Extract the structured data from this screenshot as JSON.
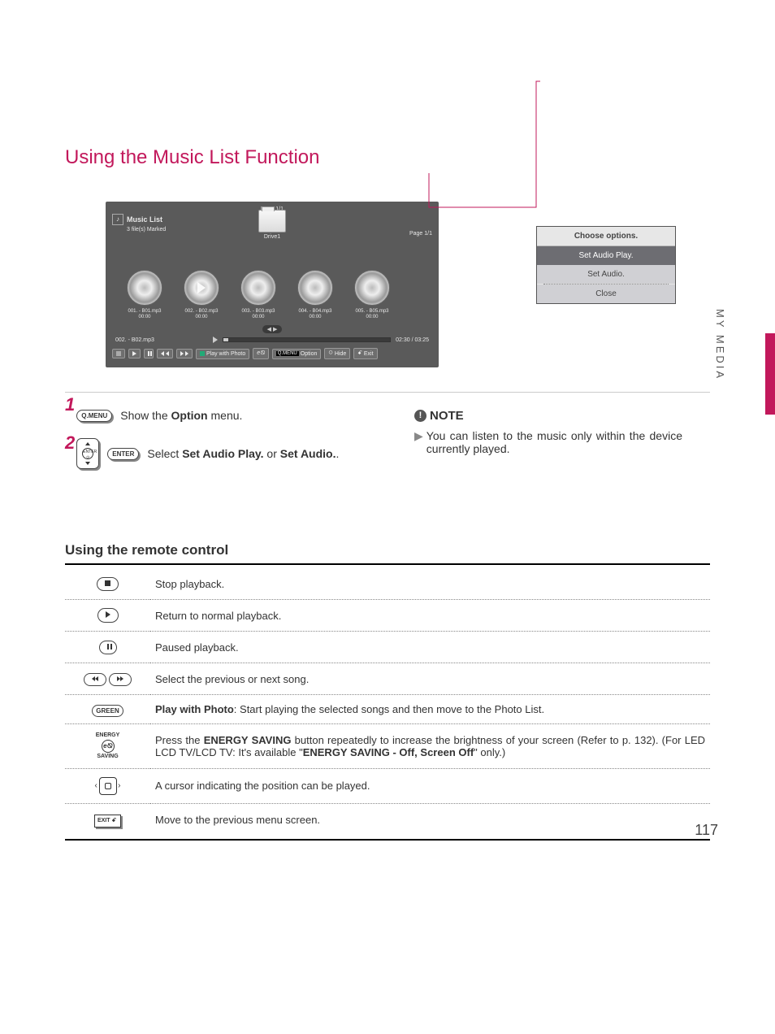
{
  "page": {
    "section_tab": "MY MEDIA",
    "page_number": "117",
    "title": "Using the Music List Function",
    "remote_heading": "Using the remote control"
  },
  "tv": {
    "page_indicator": "Page 1/1",
    "title": "Music List",
    "marked": "3 file(s) Marked",
    "drive": "Drive1",
    "inner_page": "Page 1/1",
    "tracks": [
      {
        "label": "001. - B01.mp3",
        "time": "00:00"
      },
      {
        "label": "002. - B02.mp3",
        "time": "00:00"
      },
      {
        "label": "003. - B03.mp3",
        "time": "00:00"
      },
      {
        "label": "004. - B04.mp3",
        "time": "00:00"
      },
      {
        "label": "005. - B05.mp3",
        "time": "00:00"
      }
    ],
    "scroll": "◀ ▶",
    "now_playing": "002. - B02.mp3",
    "time": "02:30 / 03:25",
    "controls": {
      "play_with_photo": "Play with Photo",
      "option": "Option",
      "qmenu": "Q.MENU",
      "hide": "Hide",
      "exit": "Exit",
      "exit_icon": "�processRequest"
    }
  },
  "options_popup": {
    "title": "Choose options.",
    "set_audio_play": "Set Audio Play.",
    "set_audio": "Set Audio.",
    "close": "Close"
  },
  "steps": {
    "step1_key": "Q.MENU",
    "step1_text_pre": "Show the ",
    "step1_bold": "Option",
    "step1_text_post": " menu.",
    "step2_enter": "ENTER",
    "step2_text_pre": "Select ",
    "step2_bold1": "Set Audio Play.",
    "step2_mid": " or ",
    "step2_bold2": "Set Audio.",
    "step2_post": "."
  },
  "note": {
    "heading": "NOTE",
    "text": "You can listen to the music only within the device currently played."
  },
  "remote_table": {
    "stop": "Stop playback.",
    "play": "Return to normal playback.",
    "pause": "Paused playback.",
    "prevnext": "Select the previous or next song.",
    "green_label": "GREEN",
    "green_bold": "Play with Photo",
    "green_rest": ": Start playing the selected songs and then move to the Photo List.",
    "energy_label_top": "ENERGY",
    "energy_label_mid": "e⦰",
    "energy_label_bottom": "SAVING",
    "energy_pre": "Press the ",
    "energy_b1": "ENERGY SAVING",
    "energy_mid": " button repeatedly to increase the brightness of your screen (Refer to p. 132). (For LED LCD TV/LCD TV: It's available \"",
    "energy_b2": "ENERGY SAVING - Off, Screen Off",
    "energy_post": "\" only.)",
    "cursor": "A cursor indicating the position can be played.",
    "exit_label": "EXIT ꗃ",
    "exit_text": "Move to the previous menu screen."
  }
}
